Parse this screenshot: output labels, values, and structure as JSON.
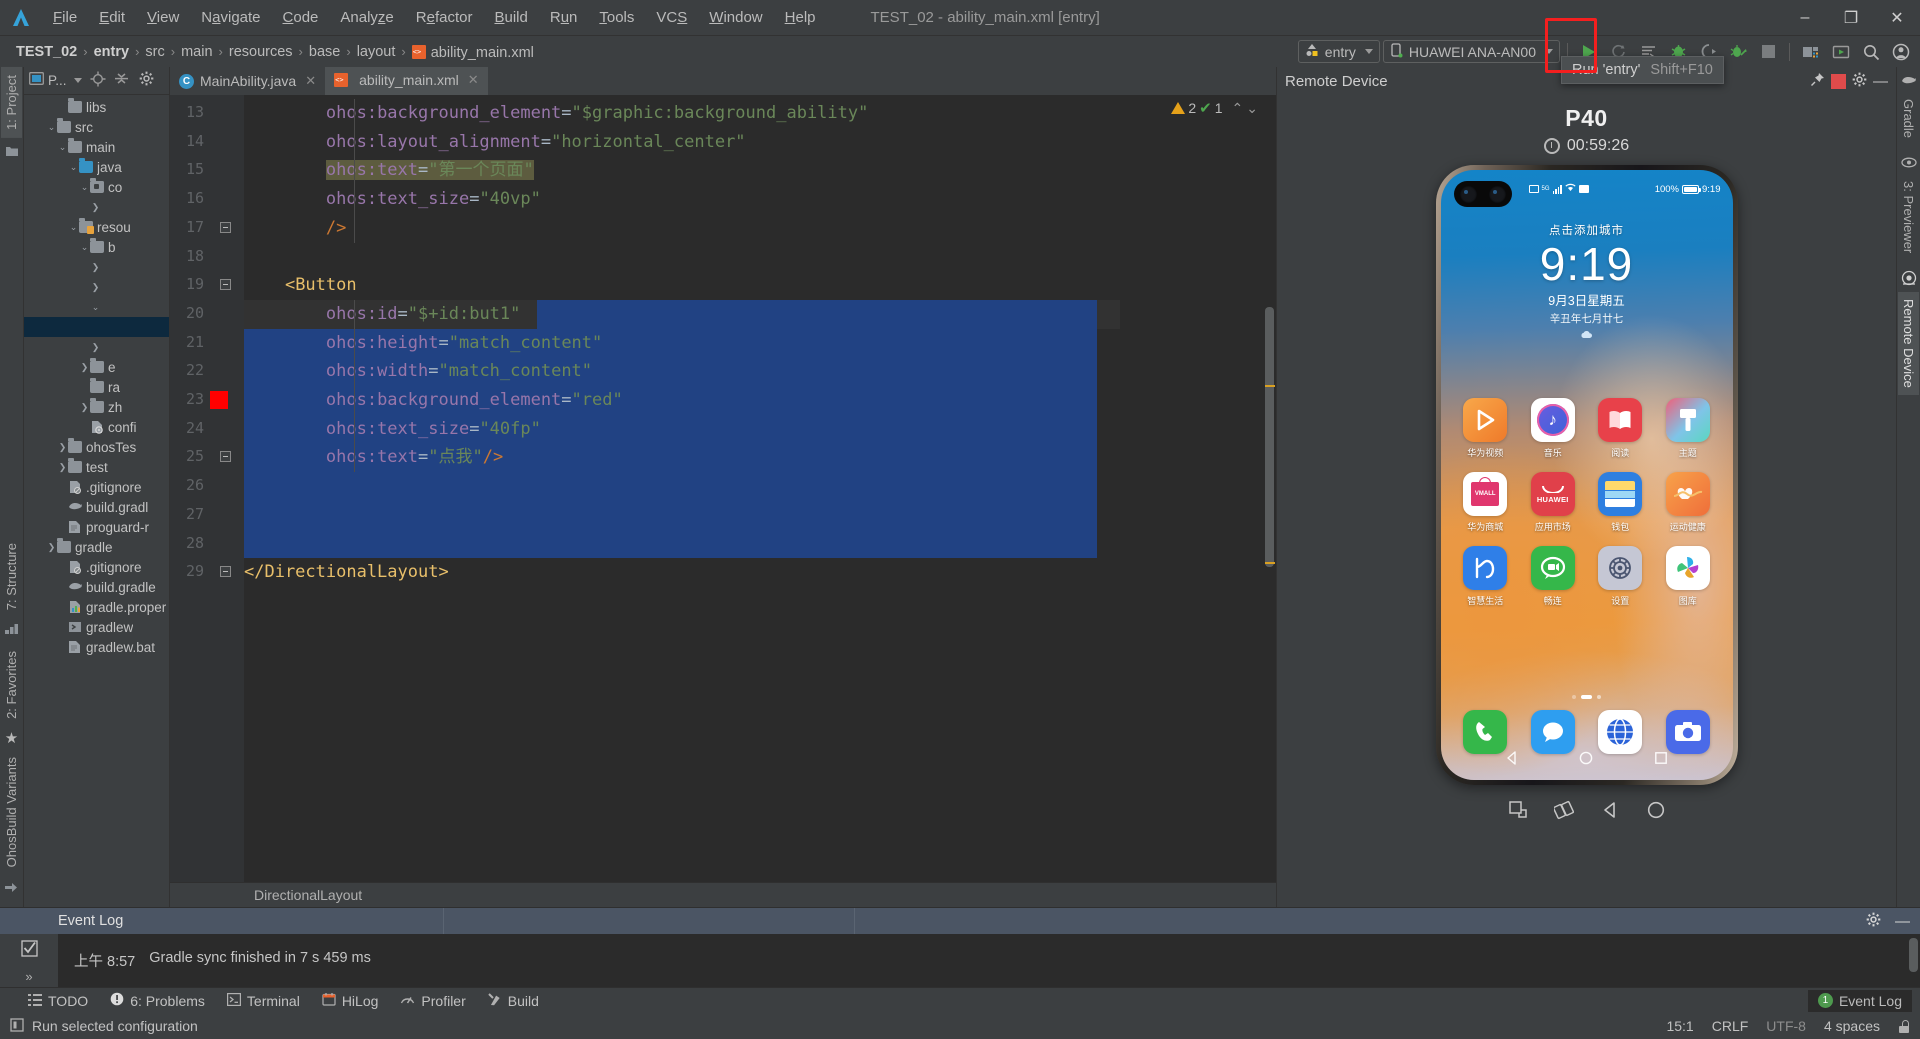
{
  "window": {
    "title": "TEST_02 - ability_main.xml [entry]"
  },
  "menu": {
    "items": [
      "File",
      "Edit",
      "View",
      "Navigate",
      "Code",
      "Analyze",
      "Refactor",
      "Build",
      "Run",
      "Tools",
      "VCS",
      "Window",
      "Help"
    ]
  },
  "window_controls": {
    "minimize": "–",
    "maximize": "❐",
    "close": "✕"
  },
  "breadcrumb": {
    "items": [
      "TEST_02",
      "entry",
      "src",
      "main",
      "resources",
      "base",
      "layout",
      "ability_main.xml"
    ],
    "separator": "›"
  },
  "toolbar": {
    "module_selector": "entry",
    "device_selector": "HUAWEI ANA-AN00",
    "run_tooltip_label": "Run 'entry'",
    "run_tooltip_shortcut": "Shift+F10",
    "icons": [
      "run-icon",
      "rerun-icon",
      "edit-configurations-icon",
      "debug-icon",
      "run-coverage-icon",
      "profile-icon",
      "stop-icon",
      "project-structure-icon",
      "device-manager-icon",
      "search-icon",
      "account-icon"
    ]
  },
  "left_rail": {
    "top": [
      "1: Project"
    ],
    "bottom": [
      "7: Structure",
      "2: Favorites",
      "OhosBuild Variants"
    ]
  },
  "right_rail": {
    "items": [
      "Gradle",
      "3: Previewer",
      "Remote Device"
    ],
    "selected": "Remote Device"
  },
  "project_panel": {
    "title": "P...",
    "tree": [
      {
        "indent": 3,
        "arrow": "",
        "icon": "folder",
        "label": "libs"
      },
      {
        "indent": 2,
        "arrow": "v",
        "icon": "folder",
        "label": "src"
      },
      {
        "indent": 3,
        "arrow": "v",
        "icon": "folder",
        "label": "main"
      },
      {
        "indent": 4,
        "arrow": "v",
        "icon": "folder-blue",
        "label": "java"
      },
      {
        "indent": 5,
        "arrow": "v",
        "icon": "folder-pkg",
        "label": "co"
      },
      {
        "indent": 6,
        "arrow": ">",
        "icon": "none",
        "label": ""
      },
      {
        "indent": 4,
        "arrow": "v",
        "icon": "folder-res",
        "label": "resou"
      },
      {
        "indent": 5,
        "arrow": "v",
        "icon": "folder",
        "label": "b"
      },
      {
        "indent": 6,
        "arrow": ">",
        "icon": "none",
        "label": ""
      },
      {
        "indent": 6,
        "arrow": ">",
        "icon": "none",
        "label": ""
      },
      {
        "indent": 6,
        "arrow": "v",
        "icon": "none",
        "label": ""
      },
      {
        "indent": 6,
        "arrow": "",
        "icon": "none",
        "label": "",
        "selected": true
      },
      {
        "indent": 6,
        "arrow": ">",
        "icon": "none",
        "label": ""
      },
      {
        "indent": 5,
        "arrow": ">",
        "icon": "folder",
        "label": "e"
      },
      {
        "indent": 5,
        "arrow": "",
        "icon": "folder",
        "label": "ra"
      },
      {
        "indent": 5,
        "arrow": ">",
        "icon": "folder",
        "label": "zh"
      },
      {
        "indent": 5,
        "arrow": "",
        "icon": "config",
        "label": "confi"
      },
      {
        "indent": 3,
        "arrow": ">",
        "icon": "folder",
        "label": "ohosTes"
      },
      {
        "indent": 3,
        "arrow": ">",
        "icon": "folder",
        "label": "test"
      },
      {
        "indent": 3,
        "arrow": "",
        "icon": "gitignore",
        "label": ".gitignore"
      },
      {
        "indent": 3,
        "arrow": "",
        "icon": "gradle",
        "label": "build.gradl"
      },
      {
        "indent": 3,
        "arrow": "",
        "icon": "file",
        "label": "proguard-r"
      },
      {
        "indent": 2,
        "arrow": ">",
        "icon": "folder",
        "label": "gradle"
      },
      {
        "indent": 3,
        "arrow": "",
        "icon": "gitignore",
        "label": ".gitignore"
      },
      {
        "indent": 3,
        "arrow": "",
        "icon": "gradle",
        "label": "build.gradle"
      },
      {
        "indent": 3,
        "arrow": "",
        "icon": "props",
        "label": "gradle.proper"
      },
      {
        "indent": 3,
        "arrow": "",
        "icon": "script",
        "label": "gradlew"
      },
      {
        "indent": 3,
        "arrow": "",
        "icon": "file",
        "label": "gradlew.bat"
      }
    ]
  },
  "editor": {
    "tabs": [
      {
        "label": "MainAbility.java",
        "icon": "java-class-icon",
        "active": false
      },
      {
        "label": "ability_main.xml",
        "icon": "xml-layout-icon",
        "active": true
      }
    ],
    "inspections": {
      "warnings": "2",
      "checks": "1"
    },
    "breadcrumb_bottom": "DirectionalLayout",
    "first_line_number": 13,
    "lines": [
      {
        "n": 13,
        "indent": 8,
        "parts": [
          {
            "t": "attr",
            "v": "ohos:background_element"
          },
          {
            "t": "punct",
            "v": "="
          },
          {
            "t": "str",
            "v": "\"$graphic:background_ability\""
          }
        ]
      },
      {
        "n": 14,
        "indent": 8,
        "parts": [
          {
            "t": "attr",
            "v": "ohos:layout_alignment"
          },
          {
            "t": "punct",
            "v": "="
          },
          {
            "t": "str",
            "v": "\"horizontal_center\""
          }
        ]
      },
      {
        "n": 15,
        "indent": 8,
        "highlight": true,
        "parts": [
          {
            "t": "attr",
            "v": "ohos:text"
          },
          {
            "t": "punct",
            "v": "="
          },
          {
            "t": "str",
            "v": "\""
          },
          {
            "t": "cjk",
            "v": "第一个页面"
          },
          {
            "t": "str",
            "v": "\""
          }
        ]
      },
      {
        "n": 16,
        "indent": 8,
        "parts": [
          {
            "t": "attr",
            "v": "ohos:text_size"
          },
          {
            "t": "punct",
            "v": "="
          },
          {
            "t": "str",
            "v": "\"40vp\""
          }
        ]
      },
      {
        "n": 17,
        "indent": 8,
        "fold": true,
        "parts": [
          {
            "t": "sym",
            "v": "/>"
          }
        ]
      },
      {
        "n": 18,
        "indent": 0,
        "parts": []
      },
      {
        "n": 19,
        "indent": 4,
        "fold": true,
        "parts": [
          {
            "t": "tag",
            "v": "<Button"
          }
        ]
      },
      {
        "n": 20,
        "indent": 8,
        "parts": [
          {
            "t": "attr",
            "v": "ohos:id"
          },
          {
            "t": "punct",
            "v": "="
          },
          {
            "t": "str",
            "v": "\"$+id:but1\""
          }
        ]
      },
      {
        "n": 21,
        "indent": 8,
        "parts": [
          {
            "t": "attr",
            "v": "ohos:height"
          },
          {
            "t": "punct",
            "v": "="
          },
          {
            "t": "str",
            "v": "\"match_content\""
          }
        ]
      },
      {
        "n": 22,
        "indent": 8,
        "parts": [
          {
            "t": "attr",
            "v": "ohos:width"
          },
          {
            "t": "punct",
            "v": "="
          },
          {
            "t": "str",
            "v": "\"match_content\""
          }
        ]
      },
      {
        "n": 23,
        "indent": 8,
        "redmark": true,
        "parts": [
          {
            "t": "attr",
            "v": "ohos:background_element"
          },
          {
            "t": "punct",
            "v": "="
          },
          {
            "t": "str",
            "v": "\"red\""
          }
        ]
      },
      {
        "n": 24,
        "indent": 8,
        "parts": [
          {
            "t": "attr",
            "v": "ohos:text_size"
          },
          {
            "t": "punct",
            "v": "="
          },
          {
            "t": "str",
            "v": "\"40fp\""
          }
        ]
      },
      {
        "n": 25,
        "indent": 8,
        "fold": true,
        "parts": [
          {
            "t": "attr",
            "v": "ohos:text"
          },
          {
            "t": "punct",
            "v": "="
          },
          {
            "t": "str",
            "v": "\""
          },
          {
            "t": "cjk",
            "v": "点我"
          },
          {
            "t": "str",
            "v": "\""
          },
          {
            "t": "sym",
            "v": "/>"
          }
        ]
      },
      {
        "n": 26,
        "indent": 0,
        "parts": []
      },
      {
        "n": 27,
        "indent": 0,
        "parts": []
      },
      {
        "n": 28,
        "indent": 0,
        "parts": []
      },
      {
        "n": 29,
        "indent": 0,
        "fold": true,
        "parts": [
          {
            "t": "tag",
            "v": "</DirectionalLayout>"
          }
        ]
      }
    ]
  },
  "remote_device": {
    "panel_title": "Remote Device",
    "model": "P40",
    "timer": "00:59:26",
    "controls": [
      "screenshot-icon",
      "rotate-icon",
      "back-icon",
      "home-icon"
    ],
    "phone": {
      "status_bar": {
        "battery_percent": "100%",
        "clock": "9:19"
      },
      "lock": {
        "city_hint": "点击添加城市",
        "time": "9:19",
        "date": "9月3日星期五",
        "lunar": "辛丑年七月廿七"
      },
      "apps": [
        {
          "name": "华为视频",
          "icon": "huawei-video-icon",
          "color": "#f08a34"
        },
        {
          "name": "音乐",
          "icon": "music-icon",
          "color": "#ffffff"
        },
        {
          "name": "阅读",
          "icon": "reader-icon",
          "color": "#e8414a"
        },
        {
          "name": "主题",
          "icon": "themes-icon",
          "color": "#7fc4e8"
        },
        {
          "name": "华为商城",
          "icon": "vmall-icon",
          "color": "#ffffff"
        },
        {
          "name": "应用市场",
          "icon": "appgallery-icon",
          "color": "#e0404a"
        },
        {
          "name": "钱包",
          "icon": "wallet-icon",
          "color": "#2e7fe0"
        },
        {
          "name": "运动健康",
          "icon": "health-icon",
          "color": "#f08a3e"
        },
        {
          "name": "智慧生活",
          "icon": "smart-life-icon",
          "color": "#2f7fe8"
        },
        {
          "name": "畅连",
          "icon": "meetime-icon",
          "color": "#35b74a"
        },
        {
          "name": "设置",
          "icon": "settings-icon",
          "color": "#c8c8d4"
        },
        {
          "name": "图库",
          "icon": "gallery-icon",
          "color": "#ffffff"
        }
      ],
      "dock": [
        {
          "name": "电话",
          "icon": "phone-icon",
          "color": "#35b74a"
        },
        {
          "name": "信息",
          "icon": "message-icon",
          "color": "#2e9ef0"
        },
        {
          "name": "浏览器",
          "icon": "browser-icon",
          "color": "#ffffff"
        },
        {
          "name": "相机",
          "icon": "camera-icon",
          "color": "#4a6ae8"
        }
      ],
      "nav": [
        "back-icon",
        "home-icon",
        "recents-icon"
      ]
    }
  },
  "event_log": {
    "title": "Event Log",
    "message_time": "上午 8:57",
    "message": "Gradle sync finished in 7 s 459 ms"
  },
  "tool_buttons": [
    {
      "label": "TODO",
      "icon": "todo-icon"
    },
    {
      "label": "6: Problems",
      "icon": "problems-icon"
    },
    {
      "label": "Terminal",
      "icon": "terminal-icon"
    },
    {
      "label": "HiLog",
      "icon": "hilog-icon"
    },
    {
      "label": "Profiler",
      "icon": "profiler-icon"
    },
    {
      "label": "Build",
      "icon": "build-icon"
    }
  ],
  "event_log_pill": {
    "count": "1",
    "label": "Event Log"
  },
  "status_bar": {
    "message": "Run selected configuration",
    "caret": "15:1",
    "line_sep": "CRLF",
    "encoding": "UTF-8",
    "indent": "4 spaces"
  },
  "colors": {
    "accent_blue": "#3592c4",
    "run_green": "#4ea64e",
    "selection": "#214283",
    "error_red": "#ff0000",
    "highlight_box": "#f41f1f"
  }
}
